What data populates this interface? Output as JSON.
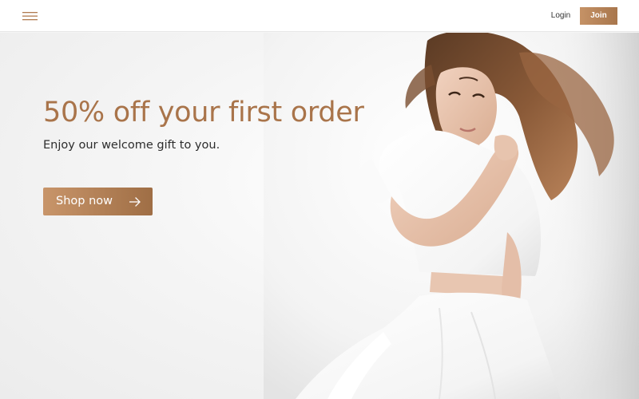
{
  "header": {
    "menu_icon": "hamburger-menu-icon",
    "login_label": "Login",
    "join_label": "Join"
  },
  "hero": {
    "title": "50% off your first order",
    "subtitle": "Enjoy our welcome gift to you.",
    "cta_label": "Shop now",
    "cta_icon": "arrow-right-icon",
    "image_subject": "model in white dress"
  },
  "colors": {
    "accent": "#a9744a",
    "button_gradient_start": "#c8956a",
    "button_gradient_end": "#9f6e45",
    "text_dark": "#2d2d2d",
    "background": "#f5f5f5"
  }
}
